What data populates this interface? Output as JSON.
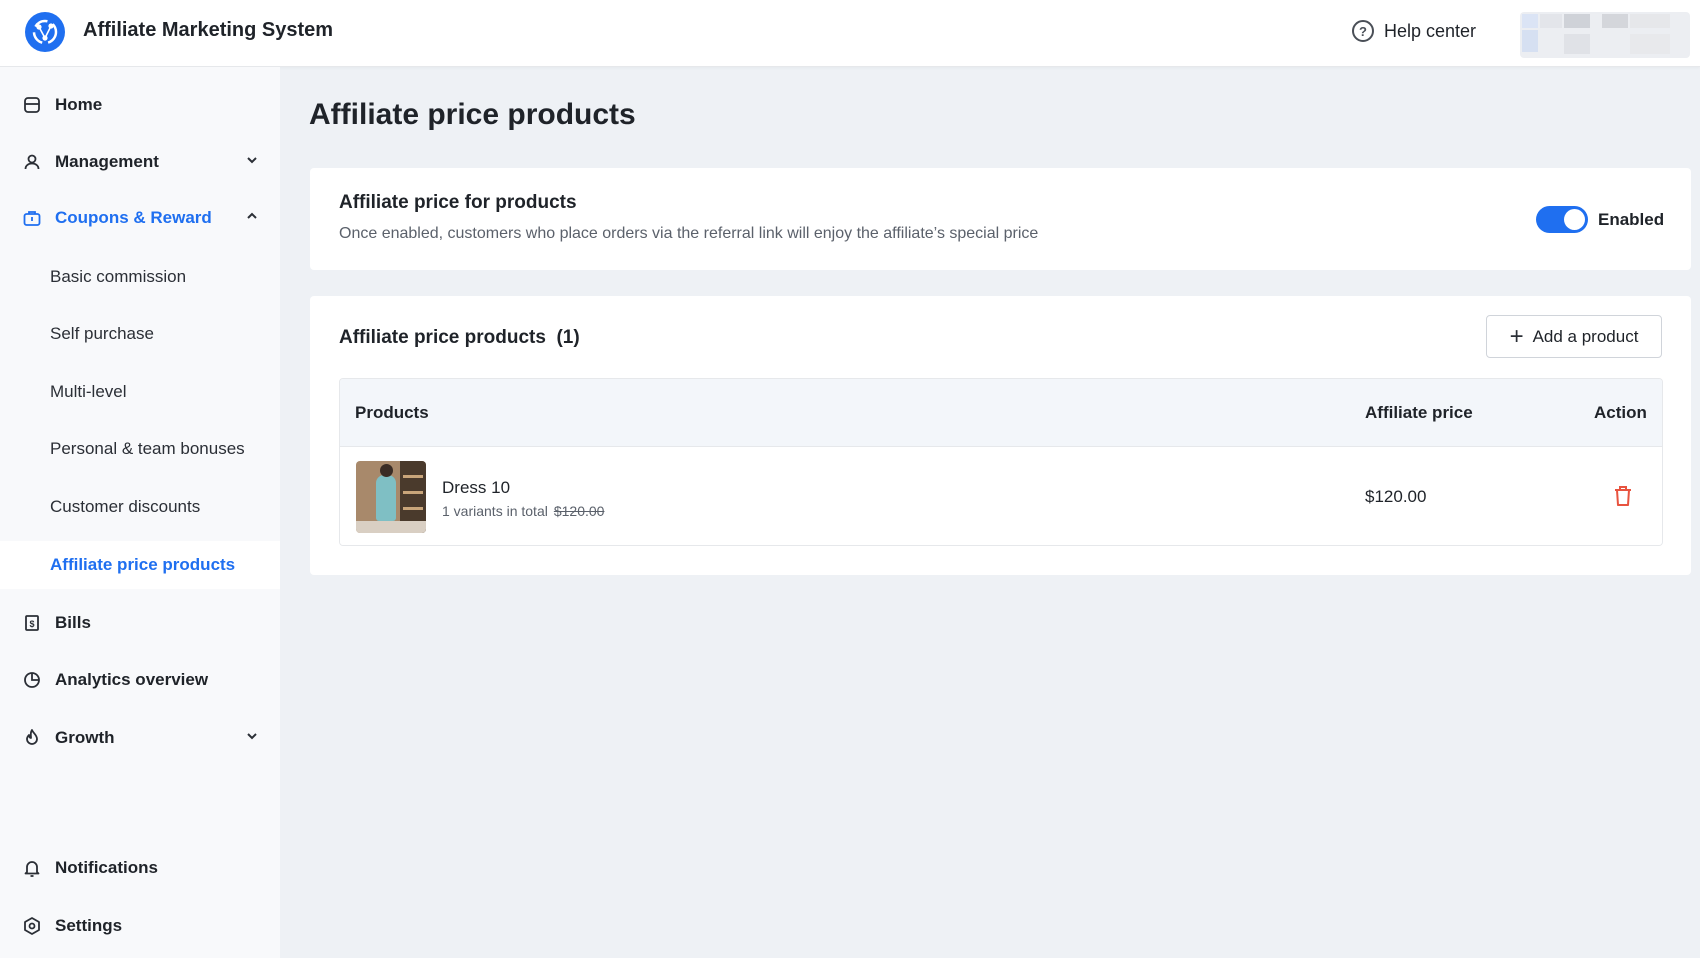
{
  "header": {
    "app_title": "Affiliate Marketing System",
    "help_label": "Help center",
    "logo_icon": "affiliate-logo-icon",
    "help_icon": "question-circle-icon"
  },
  "sidebar": {
    "items": [
      {
        "label": "Home",
        "icon": "store-icon"
      },
      {
        "label": "Management",
        "icon": "user-icon"
      },
      {
        "label": "Coupons & Reward",
        "icon": "briefcase-icon"
      },
      {
        "label": "Bills",
        "icon": "dollar-doc-icon"
      },
      {
        "label": "Analytics overview",
        "icon": "pie-chart-icon"
      },
      {
        "label": "Growth",
        "icon": "flame-icon"
      },
      {
        "label": "Notifications",
        "icon": "bell-icon"
      },
      {
        "label": "Settings",
        "icon": "hexagon-settings-icon"
      }
    ],
    "sub_items": [
      {
        "label": "Basic commission"
      },
      {
        "label": "Self purchase"
      },
      {
        "label": "Multi-level"
      },
      {
        "label": "Personal & team bonuses"
      },
      {
        "label": "Customer discounts"
      },
      {
        "label": "Affiliate price products"
      }
    ]
  },
  "main": {
    "page_title": "Affiliate price products",
    "settings_card": {
      "title": "Affiliate price for products",
      "description": "Once enabled, customers who place orders via the referral link will enjoy the affiliate’s special price",
      "toggle_label": "Enabled",
      "toggle_on": true
    },
    "products_card": {
      "title": "Affiliate price products",
      "count_label": "(1)",
      "add_button_label": "Add a product",
      "table": {
        "columns": [
          "Products",
          "Affiliate price",
          "Action"
        ],
        "rows": [
          {
            "name": "Dress 10",
            "variants": "1 variants in total",
            "original_price": "$120.00",
            "affiliate_price": "$120.00",
            "action_icon": "trash-icon"
          }
        ]
      }
    }
  },
  "colors": {
    "accent": "#1f6ff0",
    "danger": "#e8533f",
    "background": "#eef1f5",
    "sidebar_bg": "#f8f9fb"
  }
}
